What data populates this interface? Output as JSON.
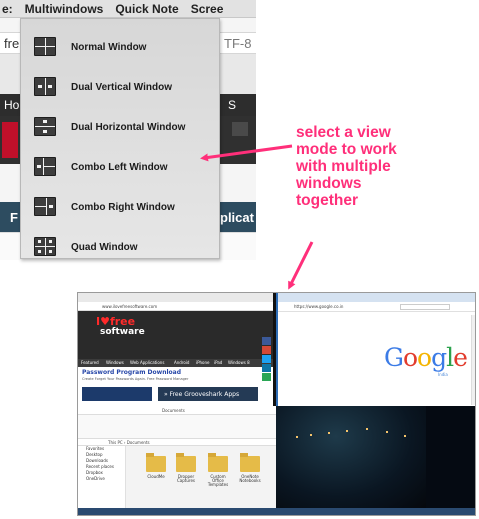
{
  "menubar": {
    "items": [
      "e:",
      "Multiwindows",
      "Quick Note",
      "Scree"
    ]
  },
  "background": {
    "address_left": "fre",
    "address_right": "TF-8",
    "nav_left": "Ho",
    "nav_right": "S",
    "nav2_left": "F",
    "nav2_right": "plicat"
  },
  "dropdown": {
    "items": [
      {
        "label": "Normal Window",
        "icon": "normal-window-icon"
      },
      {
        "label": "Dual Vertical Window",
        "icon": "dual-vertical-window-icon"
      },
      {
        "label": "Dual Horizontal Window",
        "icon": "dual-horizontal-window-icon"
      },
      {
        "label": "Combo Left Window",
        "icon": "combo-left-window-icon"
      },
      {
        "label": "Combo Right Window",
        "icon": "combo-right-window-icon"
      },
      {
        "label": "Quad Window",
        "icon": "quad-window-icon"
      }
    ]
  },
  "annotation": {
    "text": "select a view mode to work with multiple windows together",
    "color": "#ff2f7a"
  },
  "composite": {
    "top_left": {
      "address": "www.ilovefreesoftware.com",
      "logo_line1": "I♥free",
      "logo_line2": "software",
      "menu": [
        "Featured",
        "Windows",
        "Web Applications",
        "Android",
        "iPhone",
        "iPad",
        "Windows 8"
      ],
      "headline": "Password Program Download",
      "subline": "Create Forget Your Passwords Again. Free Password Manager",
      "promo": "» Free Grooveshark Apps"
    },
    "top_right": {
      "address": "https://www.google.co.in",
      "logo": "Google",
      "logo_sub": "India"
    },
    "bottom_left": {
      "title": "Documents",
      "path": "This PC › Documents",
      "nav": [
        "Favorites",
        "Desktop",
        "Downloads",
        "Recent places",
        "Dropbox",
        "OneDrive"
      ],
      "folders": [
        "CloudMe",
        "Dropper Captures",
        "Custom Office Templates",
        "OneNote Notebooks"
      ]
    }
  }
}
